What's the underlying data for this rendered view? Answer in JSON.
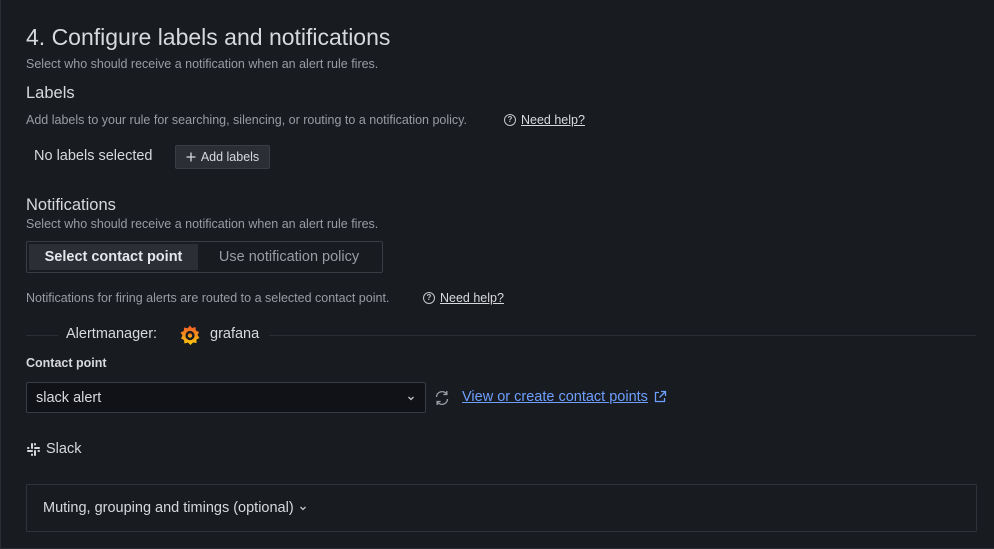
{
  "section": {
    "title": "4. Configure labels and notifications",
    "description": "Select who should receive a notification when an alert rule fires."
  },
  "labels": {
    "heading": "Labels",
    "description": "Add labels to your rule for searching, silencing, or routing to a notification policy.",
    "help_link": "Need help?",
    "empty_text": "No labels selected",
    "add_button": "Add labels"
  },
  "notifications": {
    "heading": "Notifications",
    "description": "Select who should receive a notification when an alert rule fires.",
    "tabs": [
      {
        "label": "Select contact point",
        "active": true
      },
      {
        "label": "Use notification policy",
        "active": false
      }
    ],
    "routing_text": "Notifications for firing alerts are routed to a selected contact point.",
    "help_link": "Need help?"
  },
  "alertmanager": {
    "label": "Alertmanager:",
    "value": "grafana",
    "icon": "grafana-logo-icon"
  },
  "contact_point": {
    "label": "Contact point",
    "selected": "slack alert",
    "view_link": "View or create contact points",
    "integration": "Slack"
  },
  "muting": {
    "label": "Muting, grouping and timings (optional)"
  },
  "colors": {
    "background": "#181b1f",
    "link": "#6e9fff",
    "grafana_orange": "#f05a28",
    "grafana_yellow": "#fbca0a"
  }
}
